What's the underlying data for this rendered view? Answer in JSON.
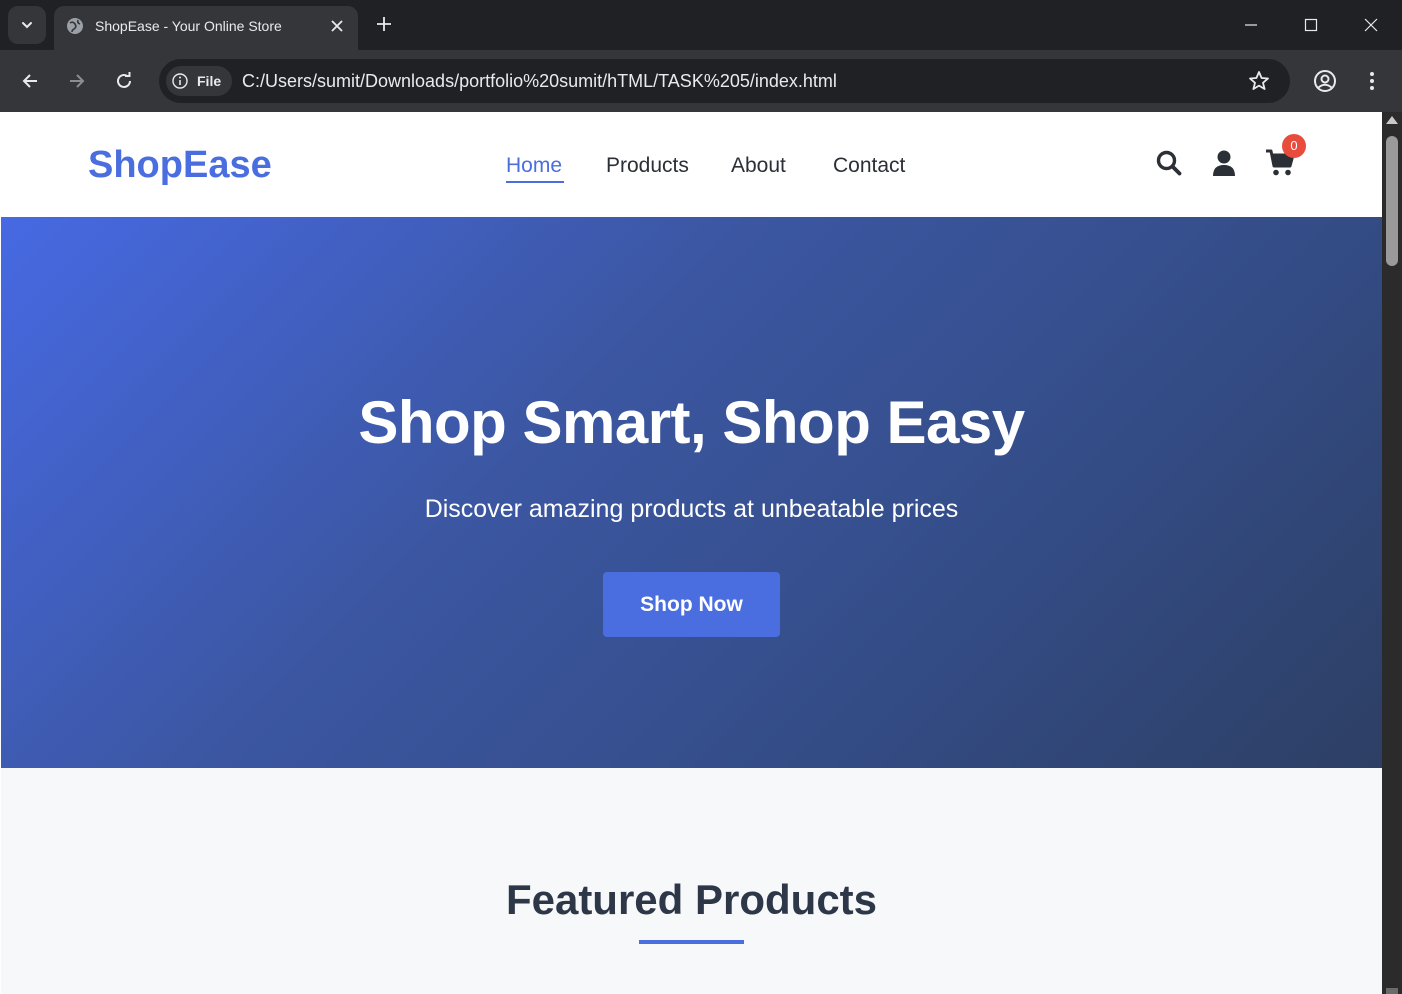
{
  "browser": {
    "tab_title": "ShopEase - Your Online Store",
    "chip_label": "File",
    "url": "C:/Users/sumit/Downloads/portfolio%20sumit/hTML/TASK%205/index.html"
  },
  "site": {
    "logo": "ShopEase",
    "nav": [
      "Home",
      "Products",
      "About",
      "Contact"
    ],
    "active_nav": "Home",
    "cart_count": "0",
    "brand_color": "#4a6ee0",
    "badge_color": "#e74c3c"
  },
  "hero": {
    "title": "Shop Smart, Shop Easy",
    "subtitle": "Discover amazing products at unbeatable prices",
    "button": "Shop Now"
  },
  "featured": {
    "title": "Featured Products"
  }
}
